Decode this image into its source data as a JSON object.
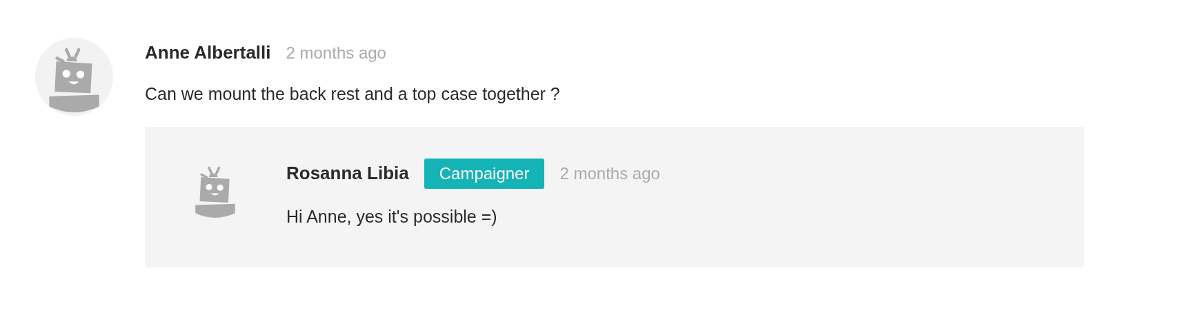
{
  "comment": {
    "author": "Anne Albertalli",
    "time": "2 months ago",
    "text": "Can we mount the back rest and a top case together ?",
    "replies": [
      {
        "author": "Rosanna Libia",
        "badge": "Campaigner",
        "time": "2 months ago",
        "text": "Hi Anne, yes it's possible =)"
      }
    ]
  }
}
